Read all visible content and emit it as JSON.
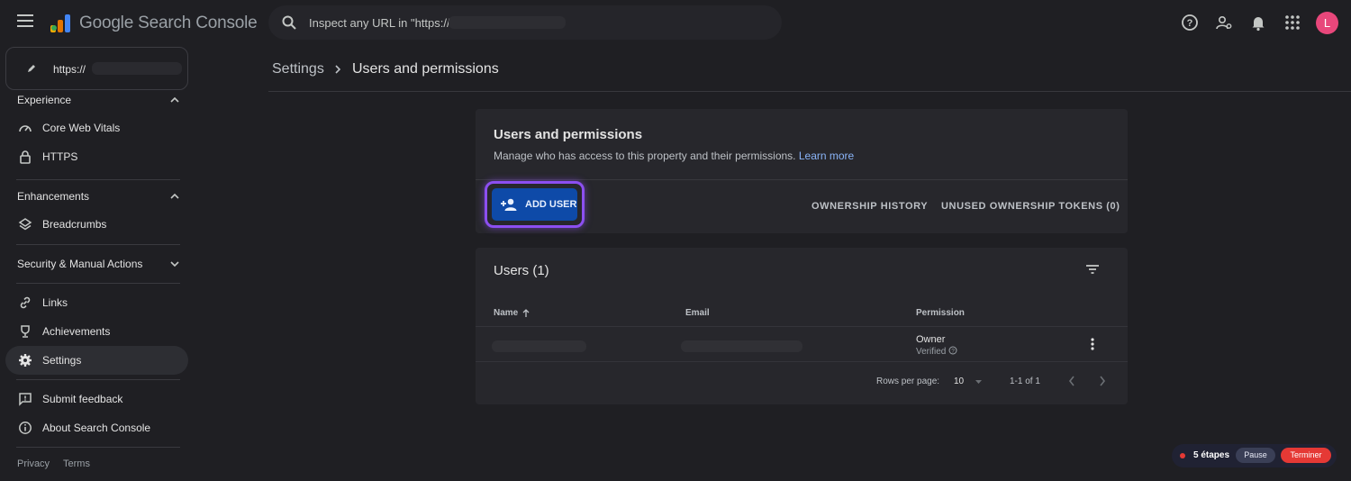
{
  "app": {
    "title": "Google Search Console",
    "search_placeholder": "Inspect any URL in \"https://"
  },
  "avatar_initial": "L",
  "property": {
    "url": "https://"
  },
  "sidebar": {
    "experience": {
      "heading": "Experience",
      "items": [
        "Core Web Vitals",
        "HTTPS"
      ]
    },
    "enhancements": {
      "heading": "Enhancements",
      "items": [
        "Breadcrumbs"
      ]
    },
    "security": {
      "heading": "Security & Manual Actions"
    },
    "items": [
      "Links",
      "Achievements",
      "Settings"
    ],
    "bottom": [
      "Submit feedback",
      "About Search Console"
    ],
    "footer": {
      "privacy": "Privacy",
      "terms": "Terms"
    }
  },
  "breadcrumb": {
    "parent": "Settings",
    "current": "Users and permissions"
  },
  "users_card": {
    "title": "Users and permissions",
    "subtitle": "Manage who has access to this property and their permissions.",
    "learn_more": "Learn more",
    "add_user": "ADD USER",
    "ownership_history": "OWNERSHIP HISTORY",
    "unused_tokens": "UNUSED OWNERSHIP TOKENS (0)"
  },
  "table": {
    "title": "Users (1)",
    "columns": {
      "name": "Name",
      "email": "Email",
      "permission": "Permission"
    },
    "rows": [
      {
        "permission": "Owner",
        "status": "Verified"
      }
    ],
    "pagination": {
      "rows_per_page_label": "Rows per page:",
      "rows_per_page": "10",
      "range": "1-1 of 1"
    }
  },
  "recorder": {
    "steps": "5 étapes",
    "pause": "Pause",
    "finish": "Terminer"
  },
  "colors": {
    "accent": "#8ab4f8",
    "primary_button": "#0e4aa8",
    "highlight": "#8c4ff1",
    "avatar": "#e8477b"
  }
}
